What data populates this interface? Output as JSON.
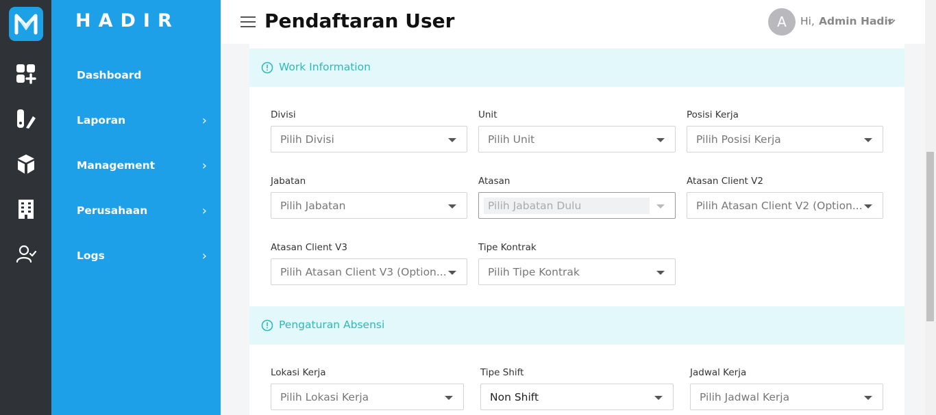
{
  "brand": {
    "name": "HADIR"
  },
  "iconbar": {
    "icons": [
      "hadir-logo-icon",
      "dashboard-icon",
      "report-icon",
      "box-icon",
      "building-icon",
      "user-check-icon"
    ]
  },
  "sidebar": {
    "items": [
      {
        "label": "Dashboard",
        "has_children": false
      },
      {
        "label": "Laporan",
        "has_children": true
      },
      {
        "label": "Management",
        "has_children": true
      },
      {
        "label": "Perusahaan",
        "has_children": true
      },
      {
        "label": "Logs",
        "has_children": true
      }
    ],
    "chevron": "›"
  },
  "header": {
    "title": "Pendaftaran User",
    "avatar_letter": "A",
    "greeting": "Hi,",
    "user_name": "Admin Hadir"
  },
  "work_info": {
    "title": "Work Information",
    "fields": {
      "divisi": {
        "label": "Divisi",
        "placeholder": "Pilih Divisi"
      },
      "unit": {
        "label": "Unit",
        "placeholder": "Pilih Unit"
      },
      "posisi": {
        "label": "Posisi Kerja",
        "placeholder": "Pilih Posisi Kerja"
      },
      "jabatan": {
        "label": "Jabatan",
        "placeholder": "Pilih Jabatan"
      },
      "atasan": {
        "label": "Atasan",
        "placeholder": "Pilih Jabatan Dulu"
      },
      "atasan_v2": {
        "label": "Atasan Client V2",
        "placeholder": "Pilih Atasan Client V2 (Option..."
      },
      "atasan_v3": {
        "label": "Atasan Client V3",
        "placeholder": "Pilih Atasan Client V3 (Option..."
      },
      "tipe_kontrak": {
        "label": "Tipe Kontrak",
        "placeholder": "Pilih Tipe Kontrak"
      }
    }
  },
  "absensi": {
    "title": "Pengaturan Absensi",
    "fields": {
      "lokasi": {
        "label": "Lokasi Kerja",
        "placeholder": "Pilih Lokasi Kerja"
      },
      "tipe_shift": {
        "label": "Tipe Shift",
        "value": "Non Shift"
      },
      "jadwal": {
        "label": "Jadwal Kerja",
        "placeholder": "Pilih Jadwal Kerja"
      }
    }
  },
  "colors": {
    "sidebar": "#1ea0e8",
    "iconbar": "#2f3337",
    "accent": "#2cb9b9",
    "section_bg": "#e3f8fa"
  }
}
